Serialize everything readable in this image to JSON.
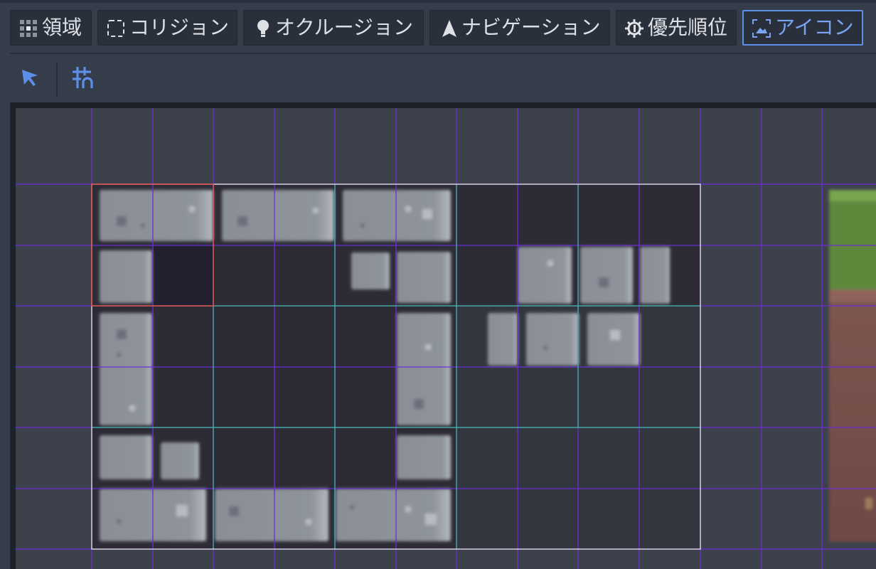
{
  "tabs": [
    {
      "label": "領域",
      "icon": "region-grid-icon"
    },
    {
      "label": "コリジョン",
      "icon": "collision-square-icon"
    },
    {
      "label": "オクルージョン",
      "icon": "occlusion-bulb-icon"
    },
    {
      "label": "ナビゲーション",
      "icon": "navigation-arrow-icon"
    },
    {
      "label": "優先順位",
      "icon": "priority-gear-icon"
    },
    {
      "label": "アイコン",
      "icon": "icon-image-icon",
      "active": true
    }
  ],
  "toolbar": {
    "tools": [
      {
        "icon": "select-cursor-icon"
      },
      {
        "icon": "grid-snap-icon"
      }
    ]
  },
  "colors": {
    "accent": "#5d8ee8",
    "background": "#363d4a",
    "panel": "#2a303b",
    "grid_line": "#6a2fd6",
    "region_line": "#3fbfa3",
    "selection": "#e0504a"
  }
}
